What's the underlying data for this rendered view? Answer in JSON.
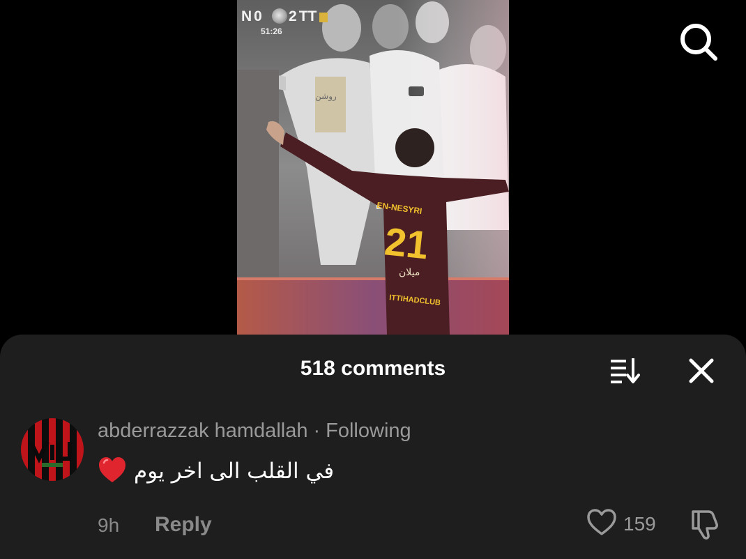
{
  "video": {
    "scoreboard": {
      "home_prefix": "N",
      "home_score": "0",
      "away_score": "2",
      "away_suffix": "TT",
      "clock": "51:26"
    },
    "player_jersey": {
      "name": "EN-NESYRI",
      "number": "21",
      "sponsor_arabic": "ميلان",
      "club_text": "ITTIHADCLUB"
    },
    "fan_shirt_text": "روشن"
  },
  "search": {
    "icon": "search-icon"
  },
  "comments_sheet": {
    "title": "518 comments",
    "sort_icon": "sort-icon",
    "close_icon": "close-icon",
    "comments": [
      {
        "author": "abderrazzak hamdallah",
        "separator": "·",
        "relation": "Following",
        "emoji": "red-heart",
        "text": "في القلب الى اخر يوم",
        "time": "9h",
        "reply_label": "Reply",
        "like_count": "159"
      }
    ]
  },
  "colors": {
    "background": "#000000",
    "sheet": "#1e1e1e",
    "muted_text": "#9a9a9a",
    "heart": "#e0252f",
    "jersey_maroon": "#4a1e22",
    "jersey_gold": "#f2c12e"
  }
}
